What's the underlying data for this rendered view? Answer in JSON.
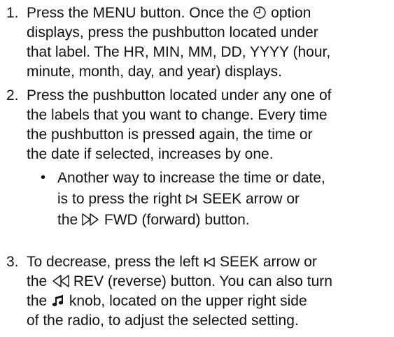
{
  "step1": {
    "num": "1.",
    "l1a": "Press the MENU button. Once the",
    "icon_clock": "clock-icon",
    "l1b": "option",
    "l2": "displays, press the pushbutton located under",
    "l3": "that label. The HR, MIN, MM, DD, YYYY (hour,",
    "l4": "minute, month, day, and year) displays."
  },
  "step2": {
    "num": "2.",
    "l1": "Press the pushbutton located under any one of",
    "l2": "the labels that you want to change. Every time",
    "l3": "the pushbutton is pressed again, the time or",
    "l4": "the date if selected, increases by one."
  },
  "bullet": {
    "mark": "•",
    "l1": "Another way to increase the time or date,",
    "l2a": "is to press the right",
    "icon_seek_right": "seek-right-icon",
    "l2b": "SEEK arrow or",
    "l3a": "the",
    "icon_fwd": "fast-forward-icon",
    "l3b": "FWD (forward) button."
  },
  "step3": {
    "num": "3.",
    "l1a": "To decrease, press the left",
    "icon_seek_left": "seek-left-icon",
    "l1b": "SEEK arrow or",
    "l2a": "the",
    "icon_rev": "rewind-icon",
    "l2b": "REV (reverse) button. You can also turn",
    "l3a": "the",
    "icon_music": "music-note-icon",
    "l3b": "knob, located on the upper right side",
    "l4": "of the radio, to adjust the selected setting."
  }
}
